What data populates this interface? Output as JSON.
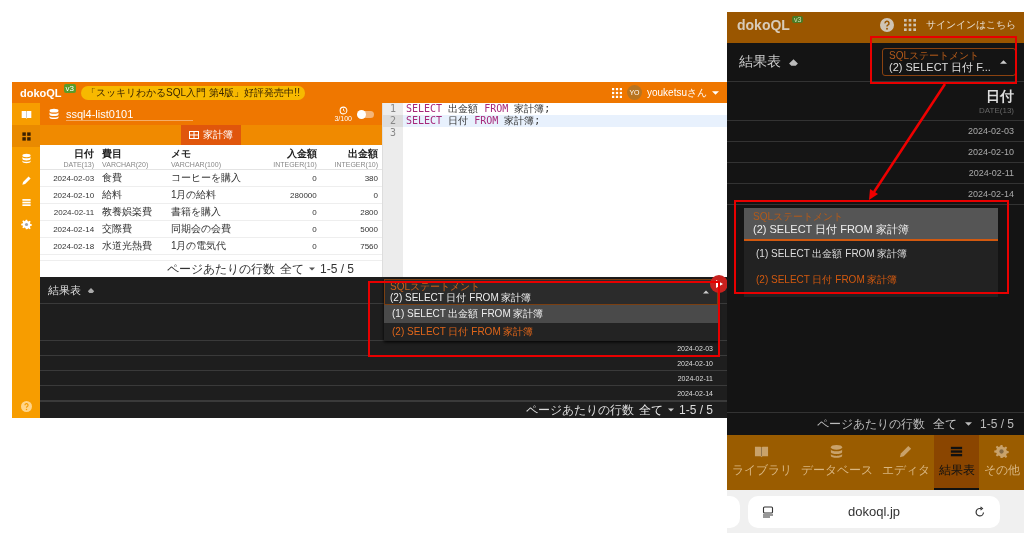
{
  "desktop": {
    "header": {
      "logo": "dokoQL",
      "version": "v3",
      "notice": "「スッキリわかるSQL入門 第4版」好評発売中!!",
      "avatar": "YO",
      "user": "youketsuさん"
    },
    "sidebar": [
      {
        "kind": "library",
        "selected": false
      },
      {
        "kind": "dashboard",
        "selected": true
      },
      {
        "kind": "database",
        "selected": false
      },
      {
        "kind": "editor",
        "selected": false
      },
      {
        "kind": "results",
        "selected": false
      },
      {
        "kind": "settings",
        "selected": false
      }
    ],
    "database": {
      "name": "ssql4-list0101",
      "history": "3/100",
      "toggle_on": false
    },
    "table_tabs": [
      {
        "label": "家計簿",
        "selected": true
      }
    ],
    "table": {
      "columns": [
        {
          "name": "日付",
          "type": "DATE(13)"
        },
        {
          "name": "費目",
          "type": "VARCHAR(20)"
        },
        {
          "name": "メモ",
          "type": "VARCHAR(100)"
        },
        {
          "name": "入金額",
          "type": "INTEGER(10)"
        },
        {
          "name": "出金額",
          "type": "INTEGER(10)"
        }
      ],
      "rows": [
        [
          "2024-02-03",
          "食費",
          "コーヒーを購入",
          "0",
          "380"
        ],
        [
          "2024-02-10",
          "給料",
          "1月の給料",
          "280000",
          "0"
        ],
        [
          "2024-02-11",
          "教養娯楽費",
          "書籍を購入",
          "0",
          "2800"
        ],
        [
          "2024-02-14",
          "交際費",
          "同期会の会費",
          "0",
          "5000"
        ],
        [
          "2024-02-18",
          "水道光熱費",
          "1月の電気代",
          "0",
          "7560"
        ]
      ],
      "footer": {
        "rows_per_page_label": "ページあたりの行数",
        "rows_per_page": "全て",
        "range": "1-5 / 5"
      }
    },
    "editor": {
      "lines": [
        {
          "number": "1",
          "active": false,
          "tokens": [
            {
              "kind": "keyword",
              "text": "SELECT"
            },
            {
              "kind": "plain",
              "text": "出金額"
            },
            {
              "kind": "keyword",
              "text": "FROM"
            },
            {
              "kind": "plain",
              "text": "家計簿;"
            }
          ]
        },
        {
          "number": "2",
          "active": true,
          "tokens": [
            {
              "kind": "keyword",
              "text": "SELECT"
            },
            {
              "kind": "plain",
              "text": "日付"
            },
            {
              "kind": "keyword",
              "text": "FROM"
            },
            {
              "kind": "plain",
              "text": "家計簿;"
            }
          ]
        },
        {
          "number": "3",
          "active": false
        }
      ]
    },
    "results": {
      "title": "結果表",
      "statement": {
        "label": "SQLステートメント",
        "value": "(2) SELECT 日付 FROM 家計簿",
        "options": [
          {
            "label": "(1) SELECT 出金額 FROM 家計簿",
            "selected": false
          },
          {
            "label": "(2) SELECT 日付 FROM 家計簿",
            "selected": true
          }
        ]
      },
      "rows": [
        "2024-02-03",
        "2024-02-10",
        "2024-02-11",
        "2024-02-14"
      ],
      "footer": {
        "rows_per_page_label": "ページあたりの行数",
        "rows_per_page": "全て",
        "range": "1-5 / 5"
      }
    }
  },
  "mobile": {
    "header": {
      "logo": "dokoQL",
      "version": "v3",
      "signin": "サインインはこちら"
    },
    "results": {
      "title": "結果表",
      "statement": {
        "label": "SQLステートメント",
        "value": "(2) SELECT 日付 F..."
      },
      "column": {
        "name": "日付",
        "type": "DATE(13)"
      },
      "rows": [
        "2024-02-03",
        "2024-02-10",
        "2024-02-11",
        "2024-02-14"
      ],
      "popup": {
        "label": "SQLステートメント",
        "value": "(2) SELECT 日付 FROM 家計簿",
        "options": [
          {
            "label": "(1) SELECT 出金額 FROM 家計簿",
            "selected": false
          },
          {
            "label": "(2) SELECT 日付 FROM 家計簿",
            "selected": true
          }
        ]
      },
      "footer": {
        "rows_per_page_label": "ページあたりの行数",
        "rows_per_page": "全て",
        "range": "1-5 / 5"
      }
    },
    "nav": [
      {
        "kind": "library",
        "label": "ライブラリ",
        "selected": false
      },
      {
        "kind": "database",
        "label": "データベース",
        "selected": false
      },
      {
        "kind": "editor",
        "label": "エディタ",
        "selected": false
      },
      {
        "kind": "results",
        "label": "結果表",
        "selected": true
      },
      {
        "kind": "settings",
        "label": "その他",
        "selected": false
      }
    ],
    "browser": {
      "url": "dokoql.jp"
    }
  }
}
